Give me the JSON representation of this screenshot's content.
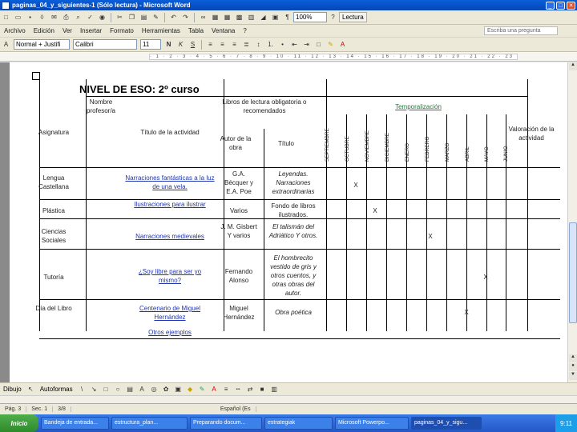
{
  "window": {
    "title": "paginas_04_y_siguientes-1 (Sólo lectura) - Microsoft Word",
    "zoom": "100%",
    "reading_button": "Lectura"
  },
  "menu": {
    "items": [
      "Archivo",
      "Edición",
      "Ver",
      "Insertar",
      "Formato",
      "Herramientas",
      "Tabla",
      "Ventana",
      "?"
    ],
    "ask_placeholder": "Escriba una pregunta"
  },
  "format": {
    "style": "Normal + Justifi",
    "font": "Calibri",
    "size": "11"
  },
  "document": {
    "heading": "NIVEL DE ESO: 2º curso",
    "headers": {
      "asignatura": "Asignatura",
      "nombre_profesor": "Nombre profesor/a",
      "titulo_actividad": "Título de la actividad",
      "libros": "Libros de lectura obligatoria o recomendados",
      "autor": "Autor de la obra",
      "titulo": "Título",
      "temporalizacion": "Temporalización",
      "valoracion": "Valoración de la actividad",
      "months": [
        "SEPTIEMBRE",
        "OCTUBRE",
        "NOVIEMBRE",
        "DICIEMBRE",
        "ENERO",
        "FEBRERO",
        "MARZO",
        "ABRIL",
        "MAYO",
        "JUNIO"
      ]
    },
    "rows": [
      {
        "asignatura": "Lengua Castellana",
        "actividad": "Narraciones fantásticas a la luz de una vela.",
        "autor": "G.A. Bécquer y E.A. Poe",
        "titulo": "Leyendas. Narraciones extraordinarias",
        "mark": "X",
        "month": 1
      },
      {
        "asignatura": "Plástica",
        "actividad": "Ilustraciones para ilustrar",
        "autor": "Varios",
        "titulo": "Fondo de libros ilustrados.",
        "mark": "X",
        "month": 2
      },
      {
        "asignatura": "Ciencias Sociales",
        "actividad": "Narraciones medievales",
        "autor": "J. M. Gisbert Y varios",
        "titulo": "El talismán del Adriático Y otros.",
        "mark": "X",
        "month": 5
      },
      {
        "asignatura": "Tutoría",
        "actividad": "¿Soy libre para ser yo mismo?",
        "autor": "Fernando Alonso",
        "titulo": "El hombrecito vestido de gris y otros cuentos, y otras obras del autor.",
        "mark": "X",
        "month": 8
      },
      {
        "asignatura": "Día del Libro",
        "actividad": "Centenario de Miguel Hernández",
        "actividad2": "Otros ejemplos",
        "autor": "Miguel Hernández",
        "titulo": "Obra poética",
        "mark": "X",
        "month": 7
      }
    ]
  },
  "drawbar": {
    "dibujo": "Dibujo",
    "autoformas": "Autoformas"
  },
  "status": {
    "page": "Pág. 3",
    "sec": "Sec. 1",
    "pages": "3/8",
    "lang": "Español (Es"
  },
  "taskbar": {
    "start": "Inicio",
    "tasks": [
      "Bandeja de entrada...",
      "estructura_plan...",
      "Preparando docum...",
      "estrategiak",
      "Microsoft Powerpo...",
      "paginas_04_y_sigu..."
    ],
    "clock": "9:11"
  }
}
